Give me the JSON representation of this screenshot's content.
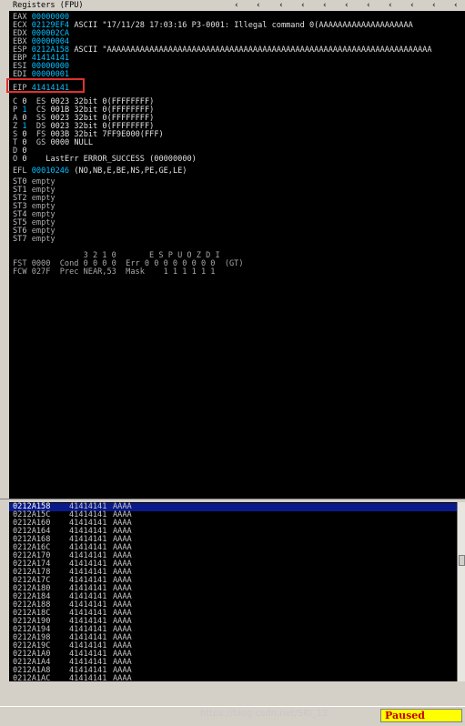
{
  "registers": {
    "title": "Registers (FPU)",
    "nav_icons": [
      "chevron-left-icon",
      "chevron-left-icon",
      "chevron-left-icon",
      "chevron-left-icon",
      "chevron-left-icon",
      "chevron-left-icon",
      "chevron-left-icon",
      "chevron-left-icon",
      "chevron-left-icon",
      "chevron-left-icon",
      "chevron-left-icon",
      "chevron-left-icon"
    ],
    "gp": [
      {
        "name": "EAX",
        "value": "00000000",
        "comment": ""
      },
      {
        "name": "ECX",
        "value": "02129EF4",
        "comment": "ASCII \"17/11/28 17:03:16 P3-0001: Illegal command 0(AAAAAAAAAAAAAAAAAAAA"
      },
      {
        "name": "EDX",
        "value": "000002CA",
        "comment": ""
      },
      {
        "name": "EBX",
        "value": "00000004",
        "comment": ""
      },
      {
        "name": "ESP",
        "value": "0212A158",
        "comment": "ASCII \"AAAAAAAAAAAAAAAAAAAAAAAAAAAAAAAAAAAAAAAAAAAAAAAAAAAAAAAAAAAAAAAAAAAAA"
      },
      {
        "name": "EBP",
        "value": "41414141",
        "comment": ""
      },
      {
        "name": "ESI",
        "value": "00000000",
        "comment": ""
      },
      {
        "name": "EDI",
        "value": "00000001",
        "comment": ""
      }
    ],
    "eip": {
      "name": "EIP",
      "value": "41414141"
    },
    "segments": [
      {
        "flag": "C",
        "bit": "0",
        "seg": "ES",
        "sel": "0023",
        "desc": "32bit 0(FFFFFFFF)"
      },
      {
        "flag": "P",
        "bit": "1",
        "seg": "CS",
        "sel": "001B",
        "desc": "32bit 0(FFFFFFFF)"
      },
      {
        "flag": "A",
        "bit": "0",
        "seg": "SS",
        "sel": "0023",
        "desc": "32bit 0(FFFFFFFF)"
      },
      {
        "flag": "Z",
        "bit": "1",
        "seg": "DS",
        "sel": "0023",
        "desc": "32bit 0(FFFFFFFF)"
      },
      {
        "flag": "S",
        "bit": "0",
        "seg": "FS",
        "sel": "003B",
        "desc": "32bit 7FF9E000(FFF)"
      },
      {
        "flag": "T",
        "bit": "0",
        "seg": "GS",
        "sel": "0000",
        "desc": "NULL"
      },
      {
        "flag": "D",
        "bit": "0",
        "seg": "",
        "sel": "",
        "desc": ""
      },
      {
        "flag": "O",
        "bit": "0",
        "seg": "",
        "sel": "",
        "desc": "LastErr ERROR_SUCCESS (00000000)"
      }
    ],
    "efl": {
      "name": "EFL",
      "value": "00010246",
      "desc": "(NO,NB,E,BE,NS,PE,GE,LE)"
    },
    "fpu": [
      {
        "name": "ST0",
        "value": "empty"
      },
      {
        "name": "ST1",
        "value": "empty"
      },
      {
        "name": "ST2",
        "value": "empty"
      },
      {
        "name": "ST3",
        "value": "empty"
      },
      {
        "name": "ST4",
        "value": "empty"
      },
      {
        "name": "ST5",
        "value": "empty"
      },
      {
        "name": "ST6",
        "value": "empty"
      },
      {
        "name": "ST7",
        "value": "empty"
      }
    ],
    "fpu_header": "               3 2 1 0       E S P U O Z D I",
    "fst_line": "FST 0000  Cond 0 0 0 0  Err 0 0 0 0 0 0 0 0  (GT)",
    "fcw_line": "FCW 027F  Prec NEAR,53  Mask    1 1 1 1 1 1"
  },
  "stack": {
    "rows": [
      {
        "addr": "0212A158",
        "hex": "41414141",
        "ascii": "AAAA",
        "selected": true
      },
      {
        "addr": "0212A15C",
        "hex": "41414141",
        "ascii": "AAAA"
      },
      {
        "addr": "0212A160",
        "hex": "41414141",
        "ascii": "AAAA"
      },
      {
        "addr": "0212A164",
        "hex": "41414141",
        "ascii": "AAAA"
      },
      {
        "addr": "0212A168",
        "hex": "41414141",
        "ascii": "AAAA"
      },
      {
        "addr": "0212A16C",
        "hex": "41414141",
        "ascii": "AAAA"
      },
      {
        "addr": "0212A170",
        "hex": "41414141",
        "ascii": "AAAA"
      },
      {
        "addr": "0212A174",
        "hex": "41414141",
        "ascii": "AAAA"
      },
      {
        "addr": "0212A178",
        "hex": "41414141",
        "ascii": "AAAA"
      },
      {
        "addr": "0212A17C",
        "hex": "41414141",
        "ascii": "AAAA"
      },
      {
        "addr": "0212A180",
        "hex": "41414141",
        "ascii": "AAAA"
      },
      {
        "addr": "0212A184",
        "hex": "41414141",
        "ascii": "AAAA"
      },
      {
        "addr": "0212A188",
        "hex": "41414141",
        "ascii": "AAAA"
      },
      {
        "addr": "0212A18C",
        "hex": "41414141",
        "ascii": "AAAA"
      },
      {
        "addr": "0212A190",
        "hex": "41414141",
        "ascii": "AAAA"
      },
      {
        "addr": "0212A194",
        "hex": "41414141",
        "ascii": "AAAA"
      },
      {
        "addr": "0212A198",
        "hex": "41414141",
        "ascii": "AAAA"
      },
      {
        "addr": "0212A19C",
        "hex": "41414141",
        "ascii": "AAAA"
      },
      {
        "addr": "0212A1A0",
        "hex": "41414141",
        "ascii": "AAAA"
      },
      {
        "addr": "0212A1A4",
        "hex": "41414141",
        "ascii": "AAAA"
      },
      {
        "addr": "0212A1A8",
        "hex": "41414141",
        "ascii": "AAAA"
      },
      {
        "addr": "0212A1AC",
        "hex": "41414141",
        "ascii": "AAAA"
      }
    ]
  },
  "status": {
    "message": "https://blog.csdn.net/SKI_12",
    "state": "Paused"
  },
  "colors": {
    "highlight_box": "#e03030",
    "selected_row": "#0a1a8a",
    "paused_bg": "#ffff00",
    "paused_text": "#c00000"
  }
}
